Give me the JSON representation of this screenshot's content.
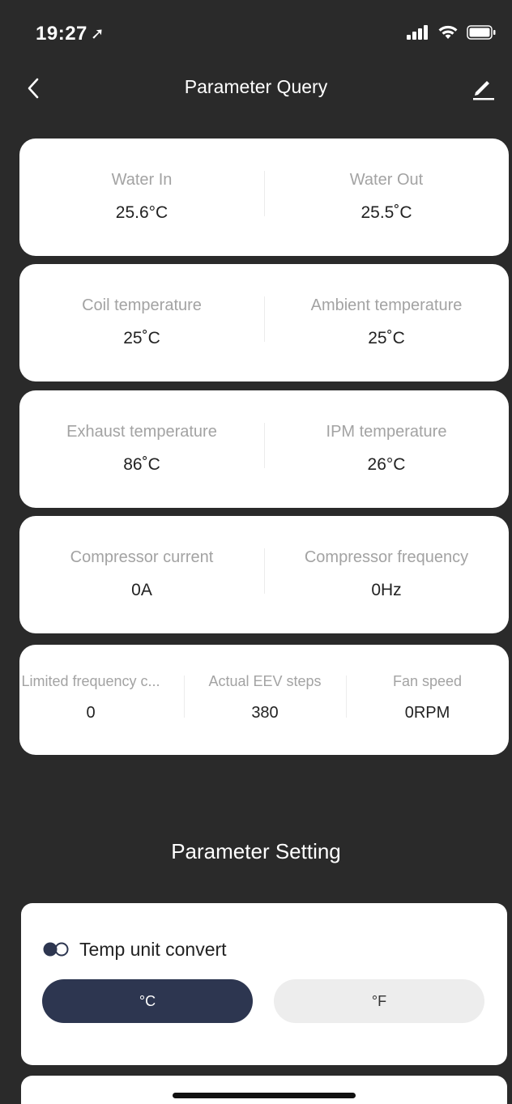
{
  "status_bar": {
    "time": "19:27",
    "location_glyph": "➚"
  },
  "nav": {
    "title": "Parameter Query"
  },
  "query_cards": [
    {
      "cells": [
        {
          "label": "Water In",
          "value": "25.6°C"
        },
        {
          "label": "Water Out",
          "value": "25.5˚C"
        }
      ]
    },
    {
      "cells": [
        {
          "label": "Coil temperature",
          "value": "25˚C"
        },
        {
          "label": "Ambient temperature",
          "value": "25˚C"
        }
      ]
    },
    {
      "cells": [
        {
          "label": "Exhaust temperature",
          "value": "86˚C"
        },
        {
          "label": "IPM temperature",
          "value": "26°C"
        }
      ]
    },
    {
      "cells": [
        {
          "label": "Compressor current",
          "value": "0A"
        },
        {
          "label": "Compressor frequency",
          "value": "0Hz"
        }
      ]
    },
    {
      "cells": [
        {
          "label": "Limited frequency c...",
          "value": "0"
        },
        {
          "label": "Actual EEV steps",
          "value": "380"
        },
        {
          "label": "Fan speed",
          "value": "0RPM"
        }
      ]
    }
  ],
  "setting": {
    "section_title": "Parameter Setting",
    "temp_unit_title": "Temp unit convert",
    "celsius_label": "°C",
    "fahrenheit_label": "°F",
    "selected": "°C"
  },
  "icons": {
    "back": "chevron-left-icon",
    "edit": "edit-pencil-icon",
    "toggle": "toggle-icon",
    "signal": "cellular-signal-icon",
    "wifi": "wifi-icon",
    "battery": "battery-icon",
    "location": "location-arrow-icon"
  },
  "colors": {
    "background": "#2a2a2a",
    "card": "#ffffff",
    "label": "#a3a3a3",
    "value": "#222222",
    "selected_button": "#2d3650",
    "unselected_button": "#ededed"
  }
}
